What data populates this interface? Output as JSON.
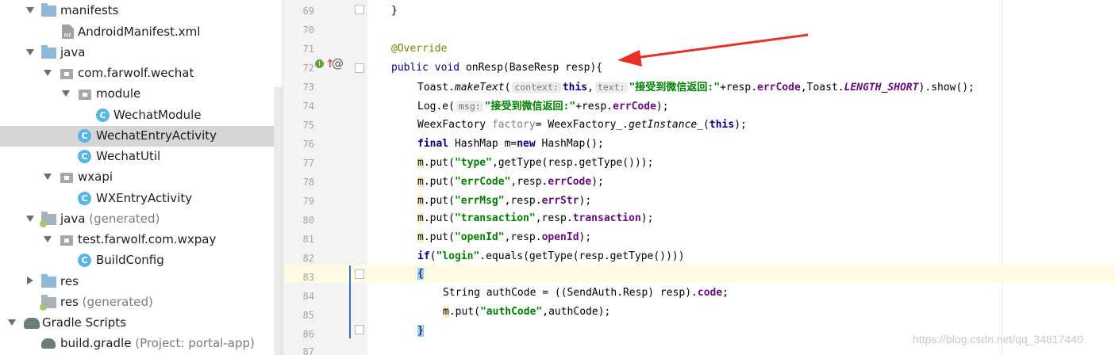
{
  "colors": {
    "keyword": "#000080",
    "string": "#008000",
    "field": "#660e7a",
    "annotation": "#808000",
    "selection": "#d5d5d5",
    "highlight": "#fdfbe3",
    "class_icon": "#59b6e4",
    "arrow": "#e8302a"
  },
  "tree": [
    {
      "label": "manifests",
      "icon": "folder-icon",
      "expander": "down",
      "indent": 0
    },
    {
      "label": "AndroidManifest.xml",
      "icon": "manifest-file-icon",
      "mf": "MF",
      "expander": "none",
      "indent": 1
    },
    {
      "label": "java",
      "icon": "folder-icon",
      "expander": "down",
      "indent": 0
    },
    {
      "label": "com.farwolf.wechat",
      "icon": "package-icon",
      "expander": "down",
      "indent": 1
    },
    {
      "label": "module",
      "icon": "package-icon",
      "expander": "down",
      "indent": 2
    },
    {
      "label": "WechatModule",
      "icon": "class-icon",
      "c": "C",
      "expander": "none",
      "indent": 3
    },
    {
      "label": "WechatEntryActivity",
      "icon": "class-icon",
      "c": "C",
      "expander": "none",
      "indent": 2,
      "selected": true
    },
    {
      "label": "WechatUtil",
      "icon": "class-icon",
      "c": "C",
      "expander": "none",
      "indent": 2
    },
    {
      "label": "wxapi",
      "icon": "package-icon",
      "expander": "down",
      "indent": 1
    },
    {
      "label": "WXEntryActivity",
      "icon": "class-icon",
      "c": "C",
      "expander": "none",
      "indent": 2
    },
    {
      "label": "java",
      "muted": "(generated)",
      "icon": "generated-folder-icon",
      "expander": "down",
      "indent": 0
    },
    {
      "label": "test.farwolf.com.wxpay",
      "icon": "package-icon",
      "expander": "down",
      "indent": 1
    },
    {
      "label": "BuildConfig",
      "icon": "class-icon",
      "c": "C",
      "expander": "none",
      "indent": 2
    },
    {
      "label": "res",
      "icon": "folder-icon",
      "expander": "right",
      "indent": 0
    },
    {
      "label": "res",
      "muted": "(generated)",
      "icon": "generated-folder-icon",
      "expander": "none",
      "indent": 0
    },
    {
      "label": "Gradle Scripts",
      "icon": "gradle-icon",
      "expander": "down",
      "indent": -1
    },
    {
      "label": "build.gradle",
      "muted": "(Project: portal-app)",
      "icon": "gradle-file-icon",
      "expander": "none",
      "indent": 0
    }
  ],
  "line_numbers": [
    "69",
    "70",
    "71",
    "72",
    "73",
    "74",
    "75",
    "76",
    "77",
    "78",
    "79",
    "80",
    "81",
    "82",
    "83",
    "84",
    "85",
    "86",
    "87"
  ],
  "gutter": {
    "implements_marker": "I",
    "override_marker": "↑",
    "at_marker": "@"
  },
  "code": {
    "l69": "}",
    "l71": "@Override",
    "l72_kw1": "public",
    "l72_kw2": "void",
    "l72_rest": " onResp(BaseResp resp){",
    "l73_a": "Toast.",
    "l73_b": "makeText",
    "l73_c": "(",
    "l73_hint1": "context:",
    "l73_this": "this",
    "l73_d": ",",
    "l73_hint2": "text:",
    "l73_str": "\"接受到微信返回:\"",
    "l73_e": "+resp.",
    "l73_f": "errCode",
    "l73_g": ",Toast.",
    "l73_h": "LENGTH_SHORT",
    "l73_i": ").show();",
    "l74_a": "Log.e(",
    "l74_hint": "msg:",
    "l74_str": "\"接受到微信返回:\"",
    "l74_b": "+resp.",
    "l74_f": "errCode",
    "l74_c": ");",
    "l75_a": "WeexFactory ",
    "l75_b": "factory",
    "l75_c": "= WeexFactory_.",
    "l75_d": "getInstance_",
    "l75_e": "(",
    "l75_this": "this",
    "l75_f": ");",
    "l76_kw": "final",
    "l76_a": " HashMap m=",
    "l76_kw2": "new",
    "l76_b": " HashMap();",
    "l77_m": "m",
    "l77_a": ".put(",
    "l77_str": "\"type\"",
    "l77_b": ",getType(resp.getType()));",
    "l78_m": "m",
    "l78_a": ".put(",
    "l78_str": "\"errCode\"",
    "l78_b": ",resp.",
    "l78_f": "errCode",
    "l78_c": ");",
    "l79_m": "m",
    "l79_a": ".put(",
    "l79_str": "\"errMsg\"",
    "l79_b": ",resp.",
    "l79_f": "errStr",
    "l79_c": ");",
    "l80_m": "m",
    "l80_a": ".put(",
    "l80_str": "\"transaction\"",
    "l80_b": ",resp.",
    "l80_f": "transaction",
    "l80_c": ");",
    "l81_m": "m",
    "l81_a": ".put(",
    "l81_str": "\"openId\"",
    "l81_b": ",resp.",
    "l81_f": "openId",
    "l81_c": ");",
    "l82_kw": "if",
    "l82_a": "(",
    "l82_str": "\"login\"",
    "l82_b": ".equals(getType(resp.getType())))",
    "l83": "{",
    "l84_a": "String authCode = ((SendAuth.Resp) resp).",
    "l84_f": "code",
    "l84_b": ";",
    "l85_m": "m",
    "l85_a": ".put(",
    "l85_str": "\"authCode\"",
    "l85_b": ",authCode);",
    "l86": "}"
  },
  "watermark": "https://blog.csdn.net/qq_34817440"
}
